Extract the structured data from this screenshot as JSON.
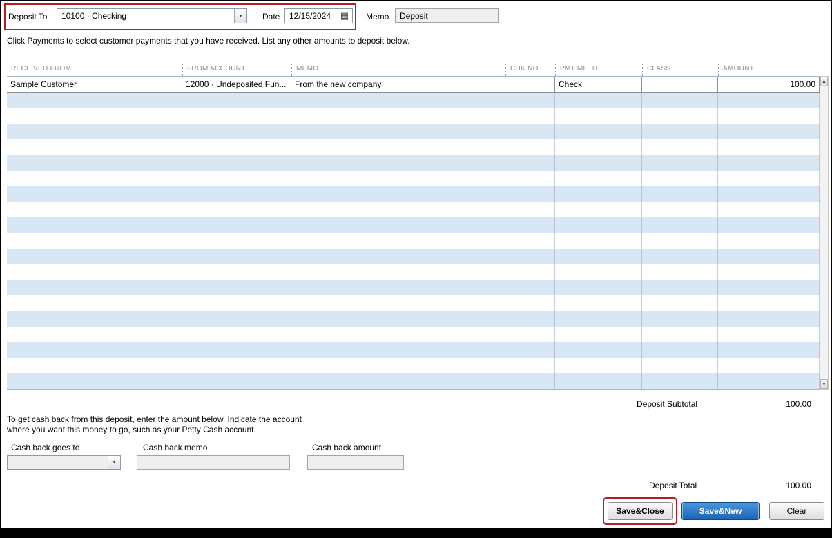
{
  "header": {
    "deposit_to_label": "Deposit To",
    "deposit_to_value": "10100 · Checking",
    "date_label": "Date",
    "date_value": "12/15/2024",
    "memo_label": "Memo",
    "memo_value": "Deposit"
  },
  "instruction": "Click Payments to select customer payments that you have received. List any other amounts to deposit below.",
  "table": {
    "columns": [
      "RECEIVED FROM",
      "FROM ACCOUNT",
      "MEMO",
      "CHK NO.",
      "PMT METH.",
      "CLASS",
      "AMOUNT"
    ],
    "rows": [
      {
        "received_from": "Sample Customer",
        "from_account": "12000 · Undeposited Fun...",
        "memo": "From the new company",
        "chk_no": "",
        "pmt_meth": "Check",
        "class": "",
        "amount": "100.00"
      }
    ],
    "empty_row_count": 19
  },
  "subtotal": {
    "label": "Deposit Subtotal",
    "value": "100.00"
  },
  "cash_back": {
    "instruction": "To get cash back from this deposit, enter the amount below.  Indicate the account\nwhere you want this money to go, such as your Petty Cash account.",
    "goes_to_label": "Cash back goes to",
    "memo_label": "Cash back memo",
    "amount_label": "Cash back amount"
  },
  "total": {
    "label": "Deposit Total",
    "value": "100.00"
  },
  "buttons": {
    "save_close": {
      "label": "Save & Close",
      "underline": 1
    },
    "save_new": {
      "label": "Save & New",
      "underline": 0
    },
    "clear": {
      "label": "Clear",
      "underline": -1
    }
  },
  "colors": {
    "highlight_red": "#b01e24",
    "row_alt_blue": "#d9e6f4",
    "primary_button_blue": "#1a64b4"
  }
}
